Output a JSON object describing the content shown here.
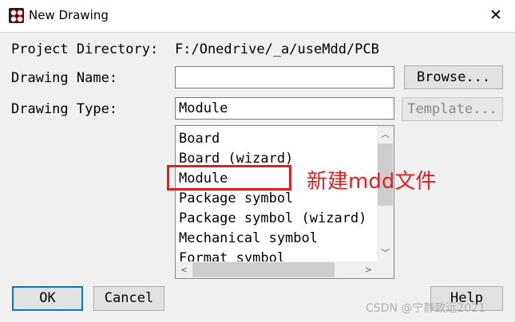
{
  "window": {
    "title": "New Drawing",
    "close_glyph": "✕"
  },
  "form": {
    "project_directory_label": "Project Directory:",
    "project_directory_value": "F:/Onedrive/_a/useMdd/PCB",
    "drawing_name_label": "Drawing Name:",
    "drawing_name_value": "",
    "browse_label": "Browse...",
    "drawing_type_label": "Drawing Type:",
    "drawing_type_value": "Module",
    "template_label": "Template..."
  },
  "drawing_types": [
    "Board",
    "Board (wizard)",
    "Module",
    "Package symbol",
    "Package symbol (wizard)",
    "Mechanical symbol",
    "Format symbol"
  ],
  "buttons": {
    "ok": "OK",
    "cancel": "Cancel",
    "help": "Help"
  },
  "annotation": {
    "text": "新建mdd文件",
    "color": "#e02020"
  },
  "watermark": "CSDN @宁静致远2021"
}
